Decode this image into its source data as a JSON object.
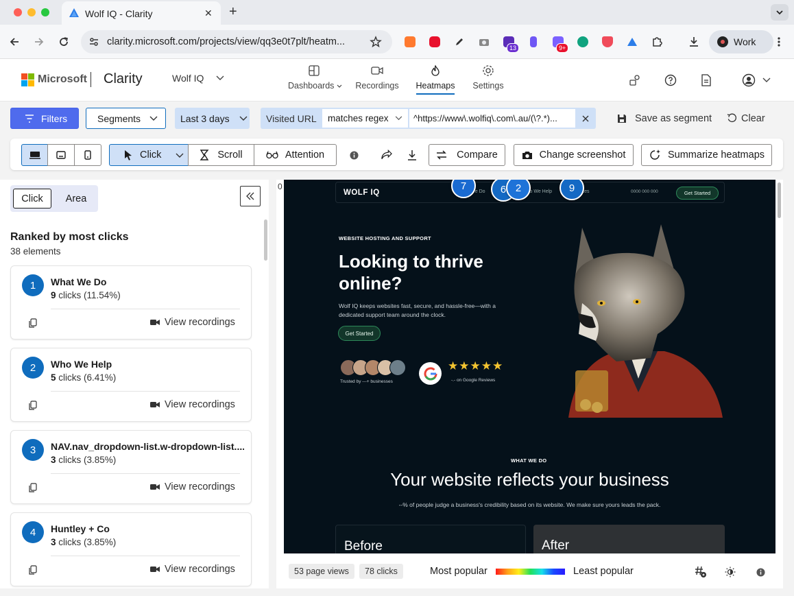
{
  "browser": {
    "tab_title": "Wolf IQ - Clarity",
    "url": "clarity.microsoft.com/projects/view/qq3e0t7plt/heatm...",
    "profile": "Work",
    "ext_badges": [
      "13",
      "9+"
    ]
  },
  "header": {
    "brand": "Microsoft",
    "product": "Clarity",
    "project": "Wolf IQ",
    "nav": [
      {
        "label": "Dashboards",
        "icon": "dashboards-icon"
      },
      {
        "label": "Recordings",
        "icon": "video-icon"
      },
      {
        "label": "Heatmaps",
        "icon": "flame-icon",
        "active": true
      },
      {
        "label": "Settings",
        "icon": "gear-icon"
      }
    ]
  },
  "filters": {
    "filters_label": "Filters",
    "segments_label": "Segments",
    "date_label": "Last 3 days",
    "url_filter": {
      "field": "Visited URL",
      "operator": "matches regex",
      "value": "^https://www\\.wolfiq\\.com\\.au/(\\?.*)..."
    },
    "save_segment_label": "Save as segment",
    "clear_label": "Clear"
  },
  "toolbar": {
    "click_label": "Click",
    "scroll_label": "Scroll",
    "attention_label": "Attention",
    "compare_label": "Compare",
    "change_screenshot_label": "Change screenshot",
    "summarize_label": "Summarize heatmaps"
  },
  "panel": {
    "tabs": [
      "Click",
      "Area"
    ],
    "heading": "Ranked by most clicks",
    "count": "38 elements",
    "view_recordings_label": "View recordings",
    "items": [
      {
        "rank": "1",
        "name": "What We Do",
        "clicks": "9",
        "pct": " clicks (11.54%)"
      },
      {
        "rank": "2",
        "name": "Who We Help",
        "clicks": "5",
        "pct": " clicks (6.41%)"
      },
      {
        "rank": "3",
        "name": "NAV.nav_dropdown-list.w-dropdown-list....",
        "clicks": "3",
        "pct": " clicks (3.85%)"
      },
      {
        "rank": "4",
        "name": "Huntley + Co",
        "clicks": "3",
        "pct": " clicks (3.85%)"
      }
    ]
  },
  "heatmap": {
    "zero_label": "0",
    "site": {
      "logo": "WOLF IQ",
      "nav_links": [
        "What We Do",
        "Who We Help",
        "Resources"
      ],
      "phone": "0000 000 000",
      "nav_cta": "Get Started",
      "eyebrow": "WEBSITE HOSTING AND SUPPORT",
      "headline_1": "Looking to thrive",
      "headline_2": "online?",
      "sub_1": "Wolf IQ keeps websites fast, secure, and hassle-free—with a",
      "sub_2": "dedicated support team around the clock.",
      "hero_cta": "Get Started",
      "trusted": "Trusted by ---+ businesses",
      "stars": "★★★★★",
      "reviews": "-.- on Google Reviews",
      "section_eyebrow": "WHAT WE DO",
      "section_title": "Your website reflects your business",
      "section_sub": "--% of people judge a business's credibility based on its website. We make sure yours leads the pack.",
      "before": "Before",
      "after": "After"
    },
    "bubbles": [
      "7",
      "6",
      "2",
      "9"
    ]
  },
  "footer": {
    "page_views": "53 page views",
    "clicks": "78 clicks",
    "most_popular": "Most popular",
    "least_popular": "Least popular"
  }
}
